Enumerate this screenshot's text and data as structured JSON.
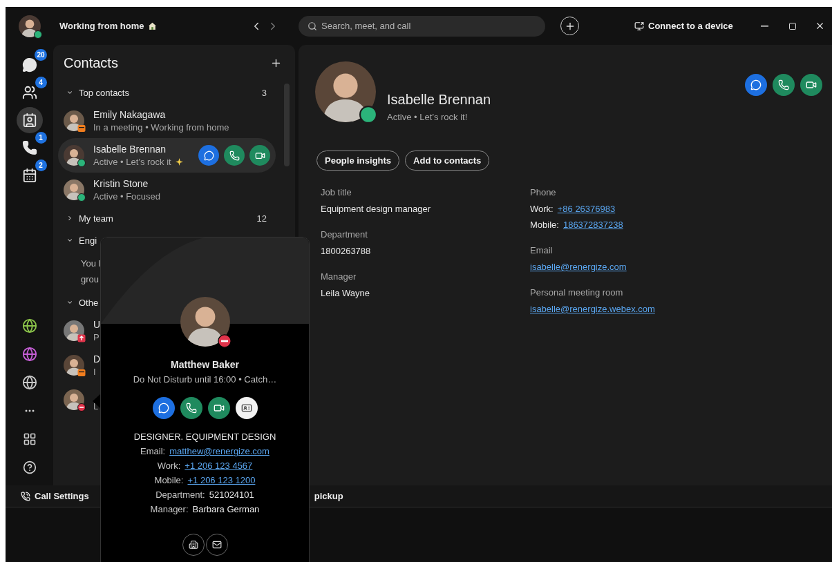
{
  "top_bar": {
    "status_text": "Working from home",
    "search": {
      "placeholder": "Search, meet, and call"
    },
    "connect_label": "Connect to a device"
  },
  "rail": {
    "items": [
      {
        "kind": "chat",
        "badge": "20",
        "selected": false
      },
      {
        "kind": "teams",
        "badge": "4",
        "selected": false
      },
      {
        "kind": "contacts",
        "selected": true
      },
      {
        "kind": "calls",
        "badge": "1",
        "selected": false
      },
      {
        "kind": "calendar",
        "badge": "2",
        "selected": false
      }
    ],
    "lower": [
      {
        "kind": "globe",
        "color": "#8bc34a"
      },
      {
        "kind": "globe",
        "color": "#c65fd6"
      },
      {
        "kind": "globe",
        "color": "#c8c8c8"
      },
      {
        "kind": "more"
      },
      {
        "kind": "apps"
      },
      {
        "kind": "help"
      }
    ]
  },
  "contacts": {
    "title": "Contacts",
    "sections": [
      {
        "label": "Top contacts",
        "count": "3",
        "expanded": true,
        "items": [
          {
            "name": "Emily Nakagawa",
            "status": "In a meeting  •  Working from home",
            "presence": {
              "kind": "meeting"
            },
            "selected": false
          },
          {
            "name": "Isabelle Brennan",
            "status": "Active  •  Let’s rock it",
            "sparkle": true,
            "presence": {
              "kind": "active"
            },
            "selected": true
          },
          {
            "name": "Kristin Stone",
            "status": "Active  •  Focused",
            "presence": {
              "kind": "active"
            },
            "selected": false
          }
        ]
      },
      {
        "label": "My team",
        "count": "12",
        "expanded": false
      },
      {
        "label": "Engi",
        "expanded": true,
        "note_lines": [
          "You l",
          "grou"
        ]
      },
      {
        "label": "Othe",
        "expanded": true,
        "items": [
          {
            "name": "U",
            "status": "P",
            "presence": {
              "kind": "presenting"
            },
            "selected": false
          },
          {
            "name": "D",
            "status": "I",
            "presence": {
              "kind": "meeting"
            },
            "selected": false
          },
          {
            "status": "L",
            "presence": {
              "kind": "dnd"
            },
            "selected": false
          }
        ]
      }
    ]
  },
  "detail": {
    "name": "Isabelle Brennan",
    "status": "Active  •  Let’s rock it!",
    "presence": {
      "kind": "active"
    },
    "actions": [
      {
        "kind": "chat"
      },
      {
        "kind": "call"
      },
      {
        "kind": "video"
      }
    ],
    "buttons": [
      "People insights",
      "Add to contacts"
    ],
    "left_fields": [
      {
        "label": "Job title",
        "value": "Equipment design manager"
      },
      {
        "label": "Department",
        "value": "1800263788"
      },
      {
        "label": "Manager",
        "value": "Leila Wayne"
      }
    ],
    "right_fields": [
      {
        "label": "Phone",
        "lines": [
          {
            "prefix": "Work:",
            "link": "+86 26376983"
          },
          {
            "prefix": "Mobile:",
            "link": "186372837238"
          }
        ]
      },
      {
        "label": "Email",
        "lines": [
          {
            "link": "isabelle@renergize.com"
          }
        ]
      },
      {
        "label": "Personal meeting room",
        "lines": [
          {
            "link": "isabelle@renergize.webex.com"
          }
        ]
      }
    ]
  },
  "popup": {
    "name": "Matthew Baker",
    "status": "Do Not Disturb until 16:00  •  Catch…",
    "presence": {
      "kind": "dnd"
    },
    "actions": [
      {
        "kind": "chat"
      },
      {
        "kind": "call"
      },
      {
        "kind": "video"
      },
      {
        "kind": "card"
      }
    ],
    "title": "DESIGNER. EQUIPMENT DESIGN",
    "details": [
      {
        "prefix": "Email:",
        "link": "matthew@renergize.com"
      },
      {
        "prefix": "Work:",
        "link": "+1 206 123 4567"
      },
      {
        "prefix": "Mobile:",
        "link": "+1 206 123 1200"
      },
      {
        "prefix": "Department:",
        "value": "521024101"
      },
      {
        "prefix": "Manager:",
        "value": "Barbara German"
      }
    ],
    "footer_actions": [
      {
        "kind": "building"
      },
      {
        "kind": "mail"
      }
    ]
  },
  "status_bar": {
    "items": [
      {
        "kind": "call_settings",
        "label": "Call Settings"
      },
      {
        "kind": "pickup",
        "label": "pickup"
      }
    ]
  }
}
